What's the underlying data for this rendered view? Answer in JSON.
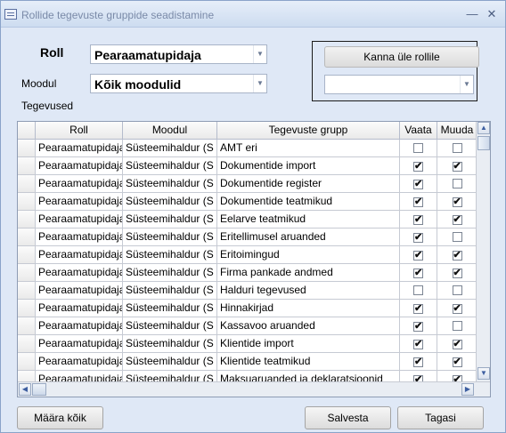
{
  "window": {
    "title": "Rollide tegevuste gruppide seadistamine"
  },
  "form": {
    "roll_label": "Roll",
    "roll_value": "Pearaamatupidaja",
    "moodul_label": "Moodul",
    "moodul_value": "Kõik moodulid",
    "tegevused_label": "Tegevused",
    "kanna_button": "Kanna üle rollile",
    "target_role_value": ""
  },
  "table": {
    "columns": [
      "Roll",
      "Moodul",
      "Tegevuste grupp",
      "Vaata",
      "Muuda"
    ],
    "rows": [
      {
        "roll": "Pearaamatupidaja",
        "moodul": "Süsteemihaldur (S",
        "grupp": "AMT eri",
        "vaata": false,
        "muuda": false
      },
      {
        "roll": "Pearaamatupidaja",
        "moodul": "Süsteemihaldur (S",
        "grupp": "Dokumentide import",
        "vaata": true,
        "muuda": true
      },
      {
        "roll": "Pearaamatupidaja",
        "moodul": "Süsteemihaldur (S",
        "grupp": "Dokumentide register",
        "vaata": true,
        "muuda": false
      },
      {
        "roll": "Pearaamatupidaja",
        "moodul": "Süsteemihaldur (S",
        "grupp": "Dokumentide teatmikud",
        "vaata": true,
        "muuda": true
      },
      {
        "roll": "Pearaamatupidaja",
        "moodul": "Süsteemihaldur (S",
        "grupp": "Eelarve teatmikud",
        "vaata": true,
        "muuda": true
      },
      {
        "roll": "Pearaamatupidaja",
        "moodul": "Süsteemihaldur (S",
        "grupp": "Eritellimusel aruanded",
        "vaata": true,
        "muuda": false
      },
      {
        "roll": "Pearaamatupidaja",
        "moodul": "Süsteemihaldur (S",
        "grupp": "Eritoimingud",
        "vaata": true,
        "muuda": true
      },
      {
        "roll": "Pearaamatupidaja",
        "moodul": "Süsteemihaldur (S",
        "grupp": "Firma pankade andmed",
        "vaata": true,
        "muuda": true
      },
      {
        "roll": "Pearaamatupidaja",
        "moodul": "Süsteemihaldur (S",
        "grupp": "Halduri tegevused",
        "vaata": false,
        "muuda": false
      },
      {
        "roll": "Pearaamatupidaja",
        "moodul": "Süsteemihaldur (S",
        "grupp": "Hinnakirjad",
        "vaata": true,
        "muuda": true
      },
      {
        "roll": "Pearaamatupidaja",
        "moodul": "Süsteemihaldur (S",
        "grupp": "Kassavoo aruanded",
        "vaata": true,
        "muuda": false
      },
      {
        "roll": "Pearaamatupidaja",
        "moodul": "Süsteemihaldur (S",
        "grupp": "Klientide import",
        "vaata": true,
        "muuda": true
      },
      {
        "roll": "Pearaamatupidaja",
        "moodul": "Süsteemihaldur (S",
        "grupp": "Klientide teatmikud",
        "vaata": true,
        "muuda": true
      },
      {
        "roll": "Pearaamatupidaja",
        "moodul": "Süsteemihaldur (S",
        "grupp": "Maksuaruanded ja deklaratsioonid",
        "vaata": true,
        "muuda": true
      }
    ]
  },
  "buttons": {
    "maara": "Määra kõik",
    "salvesta": "Salvesta",
    "tagasi": "Tagasi"
  }
}
